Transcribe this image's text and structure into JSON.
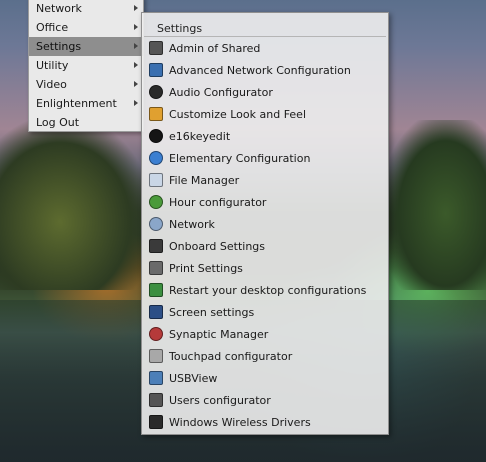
{
  "main_menu": {
    "items": [
      {
        "label": "Network",
        "submenu": true
      },
      {
        "label": "Office",
        "submenu": true
      },
      {
        "label": "Settings",
        "submenu": true,
        "active": true
      },
      {
        "label": "Utility",
        "submenu": true
      },
      {
        "label": "Video",
        "submenu": true
      },
      {
        "label": "Enlightenment",
        "submenu": true
      },
      {
        "label": "Log Out",
        "submenu": false
      }
    ]
  },
  "settings_menu": {
    "title": "Settings",
    "items": [
      {
        "label": "Admin of Shared",
        "icon": "admin-icon",
        "color": "#555555"
      },
      {
        "label": "Advanced Network Configuration",
        "icon": "network-config-icon",
        "color": "#3a6fb0"
      },
      {
        "label": "Audio Configurator",
        "icon": "speaker-icon",
        "color": "#2a2a2a"
      },
      {
        "label": "Customize Look and Feel",
        "icon": "paint-icon",
        "color": "#e0a030"
      },
      {
        "label": "e16keyedit",
        "icon": "e16-icon",
        "color": "#151515"
      },
      {
        "label": "Elementary Configuration",
        "icon": "globe-icon",
        "color": "#3b7fd1"
      },
      {
        "label": "File Manager",
        "icon": "file-manager-icon",
        "color": "#c9d6e6"
      },
      {
        "label": "Hour configurator",
        "icon": "clock-icon",
        "color": "#4a9a3a"
      },
      {
        "label": "Network",
        "icon": "network-icon",
        "color": "#8aa6c9"
      },
      {
        "label": "Onboard Settings",
        "icon": "keyboard-icon",
        "color": "#3a3a3a"
      },
      {
        "label": "Print Settings",
        "icon": "printer-icon",
        "color": "#6a6a6a"
      },
      {
        "label": "Restart your desktop configurations",
        "icon": "restart-icon",
        "color": "#3c8f40"
      },
      {
        "label": "Screen settings",
        "icon": "monitor-icon",
        "color": "#2c4f86"
      },
      {
        "label": "Synaptic Manager",
        "icon": "synaptic-icon",
        "color": "#b53a3a"
      },
      {
        "label": "Touchpad configurator",
        "icon": "touchpad-icon",
        "color": "#a8a8a8"
      },
      {
        "label": "USBView",
        "icon": "usb-icon",
        "color": "#4c7fb8"
      },
      {
        "label": "Users configurator",
        "icon": "users-icon",
        "color": "#555555"
      },
      {
        "label": "Windows Wireless Drivers",
        "icon": "wireless-icon",
        "color": "#2a2a2a"
      }
    ]
  }
}
